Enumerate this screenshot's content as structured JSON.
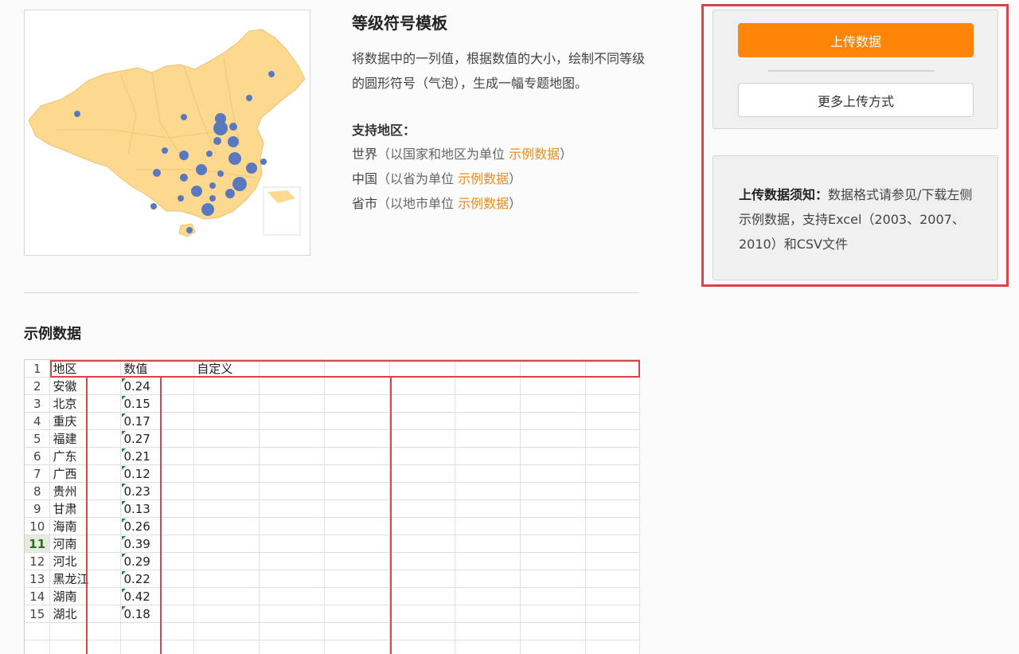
{
  "template": {
    "title": "等级符号模板",
    "description": "将数据中的一列值，根据数值的大小，绘制不同等级的圆形符号（气泡），生成一幅专题地图。",
    "support_heading": "支持地区：",
    "regions": [
      {
        "name": "世界",
        "note_open": "（以国家和地区为单位",
        "link": "示例数据",
        "note_close": "）"
      },
      {
        "name": "中国",
        "note_open": "（以省为单位",
        "link": "示例数据",
        "note_close": "）"
      },
      {
        "name": "省市",
        "note_open": "（以地市单位",
        "link": "示例数据",
        "note_close": "）"
      }
    ]
  },
  "sample": {
    "title": "示例数据",
    "headers": [
      "地区",
      "数值",
      "自定义"
    ],
    "rows": [
      [
        "安徽",
        "0.24"
      ],
      [
        "北京",
        "0.15"
      ],
      [
        "重庆",
        "0.17"
      ],
      [
        "福建",
        "0.27"
      ],
      [
        "广东",
        "0.21"
      ],
      [
        "广西",
        "0.12"
      ],
      [
        "贵州",
        "0.23"
      ],
      [
        "甘肃",
        "0.13"
      ],
      [
        "海南",
        "0.26"
      ],
      [
        "河南",
        "0.39"
      ],
      [
        "河北",
        "0.29"
      ],
      [
        "黑龙江",
        "0.22"
      ],
      [
        "湖南",
        "0.42"
      ],
      [
        "湖北",
        "0.18"
      ]
    ],
    "active_row": 11
  },
  "upload": {
    "upload_button": "上传数据",
    "more_button": "更多上传方式",
    "notice_label": "上传数据须知：",
    "notice_text": "数据格式请参见/下载左侧示例数据，支持Excel（2003、2007、2010）和CSV文件"
  },
  "colors": {
    "accent_orange": "#fe8507",
    "link_orange": "#ee8a1e",
    "highlight_red": "#d9434a",
    "map_fill": "#fcd98e",
    "bubble_blue": "#5a78c0"
  }
}
